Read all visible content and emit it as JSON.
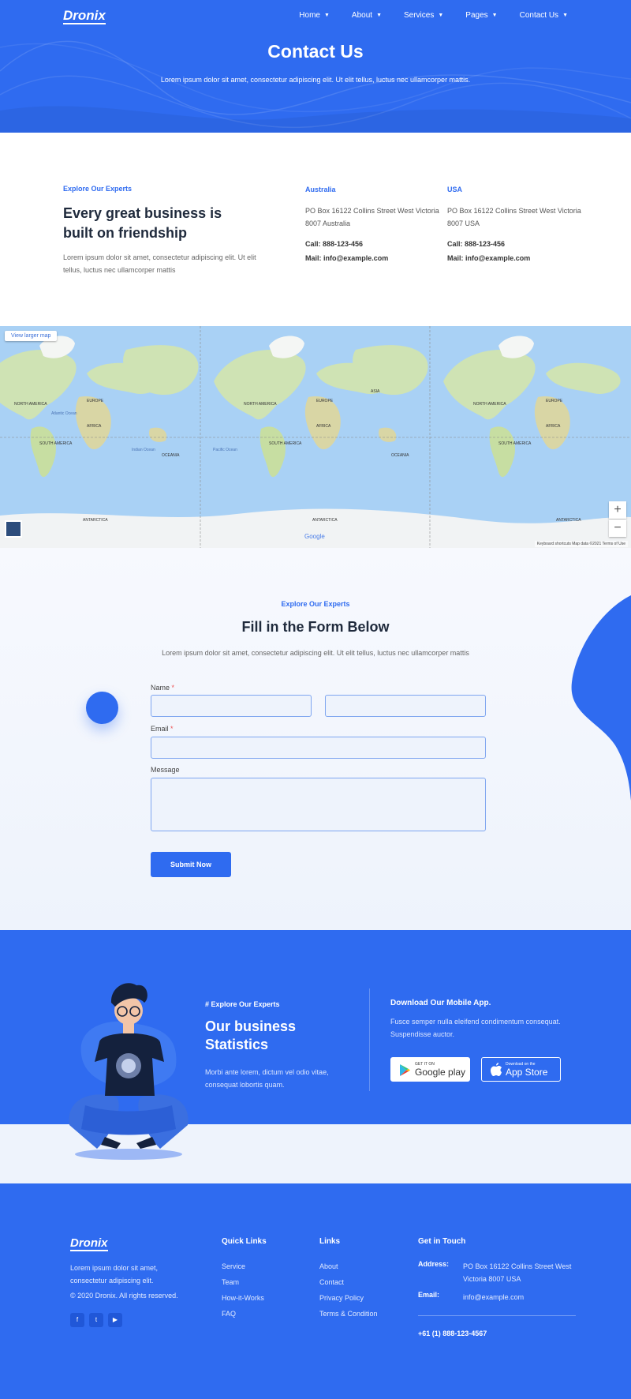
{
  "header": {
    "logo": "Dronix",
    "nav": [
      {
        "label": "Home"
      },
      {
        "label": "About"
      },
      {
        "label": "Services"
      },
      {
        "label": "Pages"
      },
      {
        "label": "Contact Us"
      }
    ],
    "title": "Contact Us",
    "subtitle": "Lorem ipsum dolor sit amet, consectetur adipiscing elit. Ut elit tellus, luctus nec ullamcorper mattis."
  },
  "info": {
    "label": "Explore Our Experts",
    "heading": "Every great business is built on friendship",
    "description": "Lorem ipsum dolor sit amet, consectetur adipiscing elit. Ut elit tellus, luctus nec ullamcorper mattis",
    "offices": [
      {
        "country": "Australia",
        "address": "PO Box 16122 Collins Street West Victoria 8007 Australia",
        "call": "Call: 888-123-456",
        "mail": "Mail: info@example.com"
      },
      {
        "country": "USA",
        "address": "PO Box 16122 Collins Street West Victoria 8007 USA",
        "call": "Call: 888-123-456",
        "mail": "Mail: info@example.com"
      }
    ]
  },
  "map": {
    "view_larger": "View larger map",
    "zoom_in": "+",
    "zoom_out": "−",
    "google": "Google",
    "footer": "Keyboard shortcuts   Map data ©2021   Terms of Use",
    "labels": [
      "NORTH AMERICA",
      "EUROPE",
      "ASIA",
      "AFRICA",
      "SOUTH AMERICA",
      "OCEANIA",
      "ANTARCTICA",
      "Atlantic Ocean",
      "Indian Ocean",
      "Pacific Ocean"
    ]
  },
  "form": {
    "label": "Explore Our Experts",
    "title": "Fill in the Form Below",
    "subtitle": "Lorem ipsum dolor sit amet, consectetur adipiscing elit. Ut elit tellus, luctus nec ullamcorper mattis",
    "name_label": "Name",
    "email_label": "Email",
    "message_label": "Message",
    "required_mark": "*",
    "submit": "Submit Now"
  },
  "stats": {
    "label": "# Explore Our Experts",
    "title": "Our business Statistics",
    "description": "Morbi ante lorem, dictum vel odio vitae, consequat lobortis quam.",
    "app_title": "Download Our Mobile App.",
    "app_description": "Fusce semper nulla eleifend condimentum consequat. Suspendisse auctor.",
    "google_play_small": "GET IT ON",
    "google_play_big": "Google play",
    "app_store_small": "Download on the",
    "app_store_big": "App Store"
  },
  "footer": {
    "logo": "Dronix",
    "about": "Lorem ipsum dolor sit amet, consectetur adipiscing elit.",
    "copyright": "© 2020 Dronix. All rights reserved.",
    "quick_links_title": "Quick Links",
    "quick_links": [
      "Service",
      "Team",
      "How-it-Works",
      "FAQ"
    ],
    "links_title": "Links",
    "links": [
      "About",
      "Contact",
      "Privacy Policy",
      "Terms & Condition"
    ],
    "contact_title": "Get in Touch",
    "address_label": "Address:",
    "address": "PO Box 16122 Collins Street West Victoria 8007 USA",
    "email_label": "Email:",
    "email": "info@example.com",
    "phone": "+61 (1) 888-123-4567"
  },
  "colors": {
    "brand": "#2f6bf0",
    "text_dark": "#1f2a3c",
    "light_bg": "#eef3fc"
  }
}
